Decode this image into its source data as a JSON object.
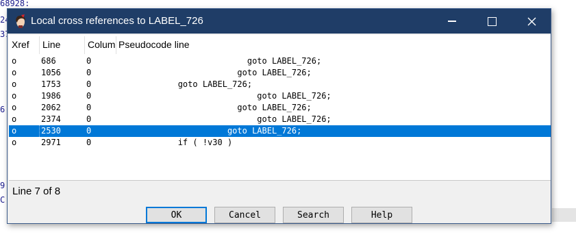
{
  "background": {
    "fragments": [
      "68928:",
      "24",
      "37",
      "6",
      "9",
      "C"
    ]
  },
  "dialog": {
    "title": "Local cross references to LABEL_726",
    "icon": "ida-app-icon",
    "window_controls": [
      "minimize",
      "maximize",
      "close"
    ]
  },
  "table": {
    "columns": [
      "Xref",
      "Line",
      "Column",
      "Pseudocode line"
    ],
    "rows": [
      {
        "xref": "o",
        "line": "686",
        "column": "0",
        "code": "                          goto LABEL_726;"
      },
      {
        "xref": "o",
        "line": "1056",
        "column": "0",
        "code": "                        goto LABEL_726;"
      },
      {
        "xref": "o",
        "line": "1753",
        "column": "0",
        "code": "            goto LABEL_726;"
      },
      {
        "xref": "o",
        "line": "1986",
        "column": "0",
        "code": "                            goto LABEL_726;"
      },
      {
        "xref": "o",
        "line": "2062",
        "column": "0",
        "code": "                        goto LABEL_726;"
      },
      {
        "xref": "o",
        "line": "2374",
        "column": "0",
        "code": "                            goto LABEL_726;"
      },
      {
        "xref": "o",
        "line": "2530",
        "column": "0",
        "code": "                      goto LABEL_726;"
      },
      {
        "xref": "o",
        "line": "2971",
        "column": "0",
        "code": "            if ( !v30 )"
      }
    ],
    "selected_row": 7
  },
  "status": "Line 7 of 8",
  "buttons": {
    "ok": "OK",
    "cancel": "Cancel",
    "search": "Search",
    "help": "Help"
  },
  "colors": {
    "title_bar": "#1f3d67",
    "selection": "#0078d7"
  }
}
